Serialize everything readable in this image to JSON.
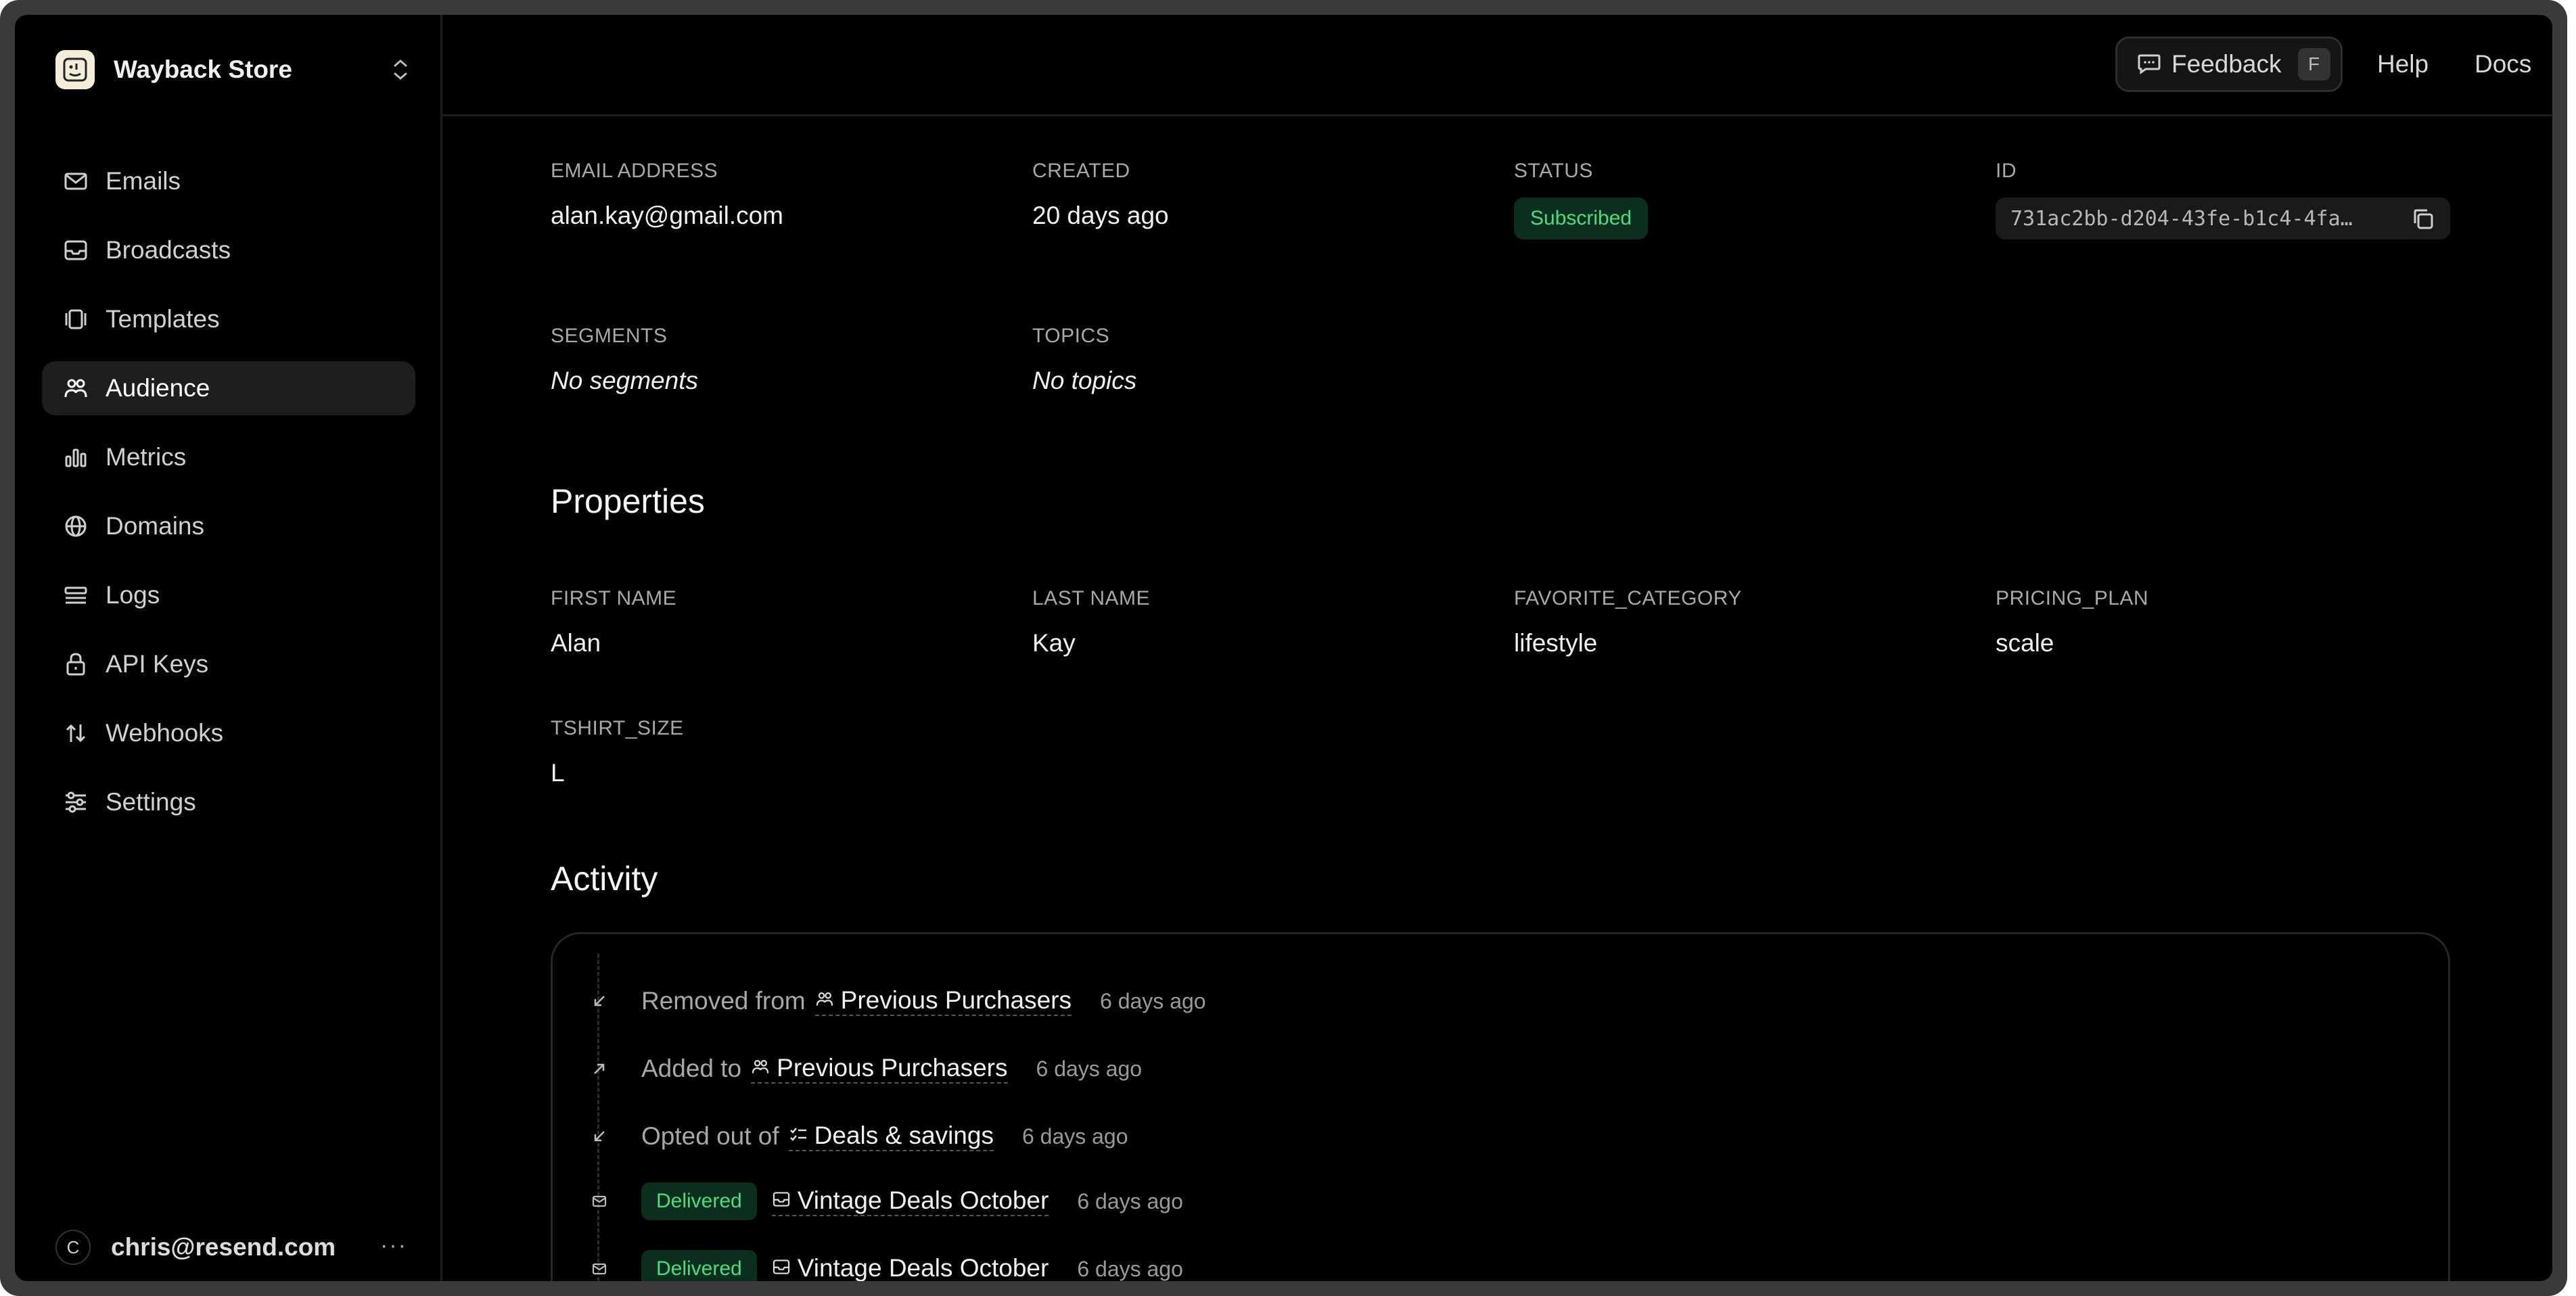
{
  "sidebar": {
    "brand": "Wayback Store",
    "items": [
      {
        "label": "Emails",
        "icon": "mail-icon"
      },
      {
        "label": "Broadcasts",
        "icon": "inbox-icon"
      },
      {
        "label": "Templates",
        "icon": "templates-icon"
      },
      {
        "label": "Audience",
        "icon": "users-icon",
        "active": true
      },
      {
        "label": "Metrics",
        "icon": "bar-chart-icon"
      },
      {
        "label": "Domains",
        "icon": "globe-icon"
      },
      {
        "label": "Logs",
        "icon": "logs-icon"
      },
      {
        "label": "API Keys",
        "icon": "lock-icon"
      },
      {
        "label": "Webhooks",
        "icon": "webhook-arrows-icon"
      },
      {
        "label": "Settings",
        "icon": "sliders-icon"
      }
    ],
    "user": {
      "initial": "C",
      "email": "chris@resend.com",
      "more": "···"
    }
  },
  "topbar": {
    "feedback_label": "Feedback",
    "feedback_shortcut": "F",
    "help": "Help",
    "docs": "Docs"
  },
  "contact": {
    "email_label": "EMAIL ADDRESS",
    "email": "alan.kay@gmail.com",
    "created_label": "CREATED",
    "created": "20 days ago",
    "status_label": "STATUS",
    "status": "Subscribed",
    "id_label": "ID",
    "id": "731ac2bb-d204-43fe-b1c4-4fa…",
    "segments_label": "SEGMENTS",
    "segments": "No segments",
    "topics_label": "TOPICS",
    "topics": "No topics"
  },
  "properties": {
    "title": "Properties",
    "first_name_label": "FIRST NAME",
    "first_name": "Alan",
    "last_name_label": "LAST NAME",
    "last_name": "Kay",
    "favorite_category_label": "FAVORITE_CATEGORY",
    "favorite_category": "lifestyle",
    "pricing_plan_label": "PRICING_PLAN",
    "pricing_plan": "scale",
    "tshirt_size_label": "TSHIRT_SIZE",
    "tshirt_size": "L"
  },
  "activity": {
    "title": "Activity",
    "events": [
      {
        "prefix": "Removed from",
        "target": "Previous Purchasers",
        "time": "6 days ago"
      },
      {
        "prefix": "Added to",
        "target": "Previous Purchasers",
        "time": "6 days ago"
      },
      {
        "prefix": "Opted out of",
        "target": "Deals & savings",
        "time": "6 days ago"
      },
      {
        "badge": "Delivered",
        "subject": "Vintage Deals October",
        "time": "6 days ago"
      },
      {
        "badge": "Delivered",
        "subject": "Vintage Deals October",
        "time": "6 days ago"
      }
    ]
  },
  "colors": {
    "background": "#000000",
    "success_bg": "#0c2e1e",
    "success_text": "#4ade80",
    "active_nav": "#1e1e1e"
  }
}
